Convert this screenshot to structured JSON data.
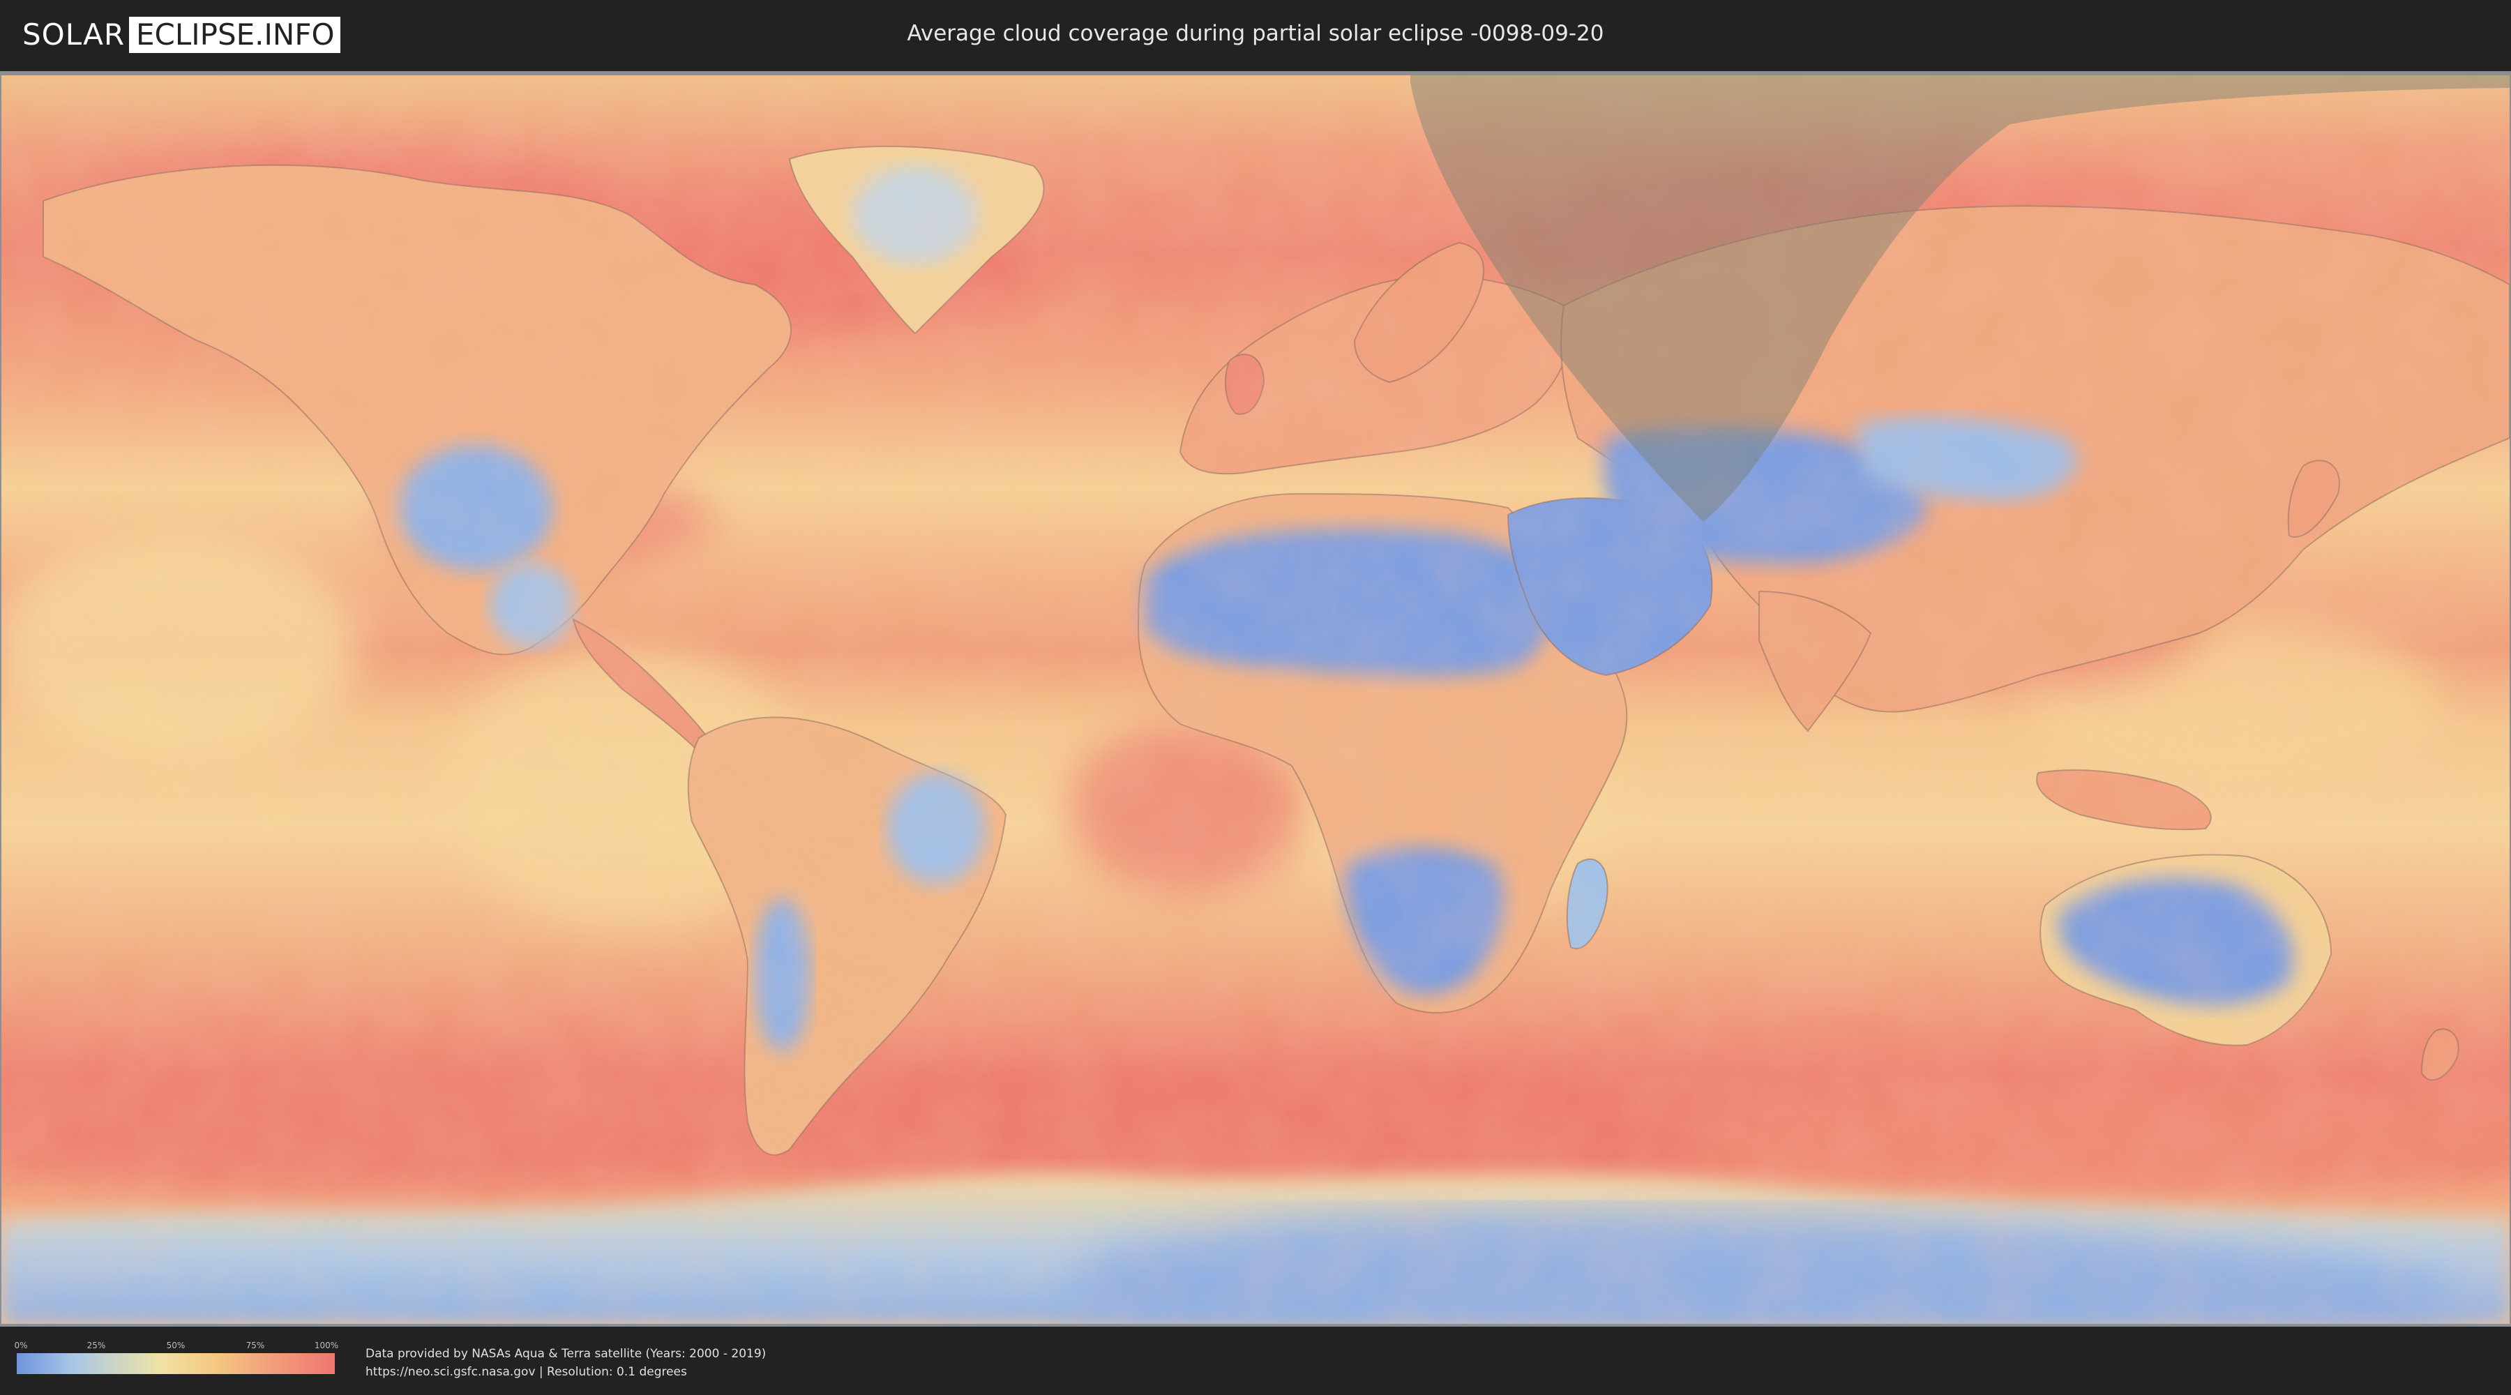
{
  "header": {
    "logo": {
      "part1": "SOLAR",
      "part2": "ECLIPSE.INFO"
    },
    "title": "Average cloud coverage during partial solar eclipse -0098-09-20"
  },
  "map": {
    "content": "world cloud coverage map",
    "colors": {
      "low": "#6f93dd",
      "mid_low": "#a9c8e6",
      "mid": "#efe2a6",
      "mid_high": "#f5c982",
      "high": "#ee7670",
      "ocean_base": "#f1ad7d",
      "eclipse_shadow": "#7b7e72",
      "borders": "#6b4f4f"
    }
  },
  "footer": {
    "legend": {
      "ticks": [
        "0%",
        "25%",
        "50%",
        "75%",
        "100%"
      ]
    },
    "credits": {
      "line1": "Data provided by NASAs Aqua & Terra satellite (Years: 2000 - 2019)",
      "line2": "https://neo.sci.gsfc.nasa.gov | Resolution: 0.1 degrees"
    }
  }
}
